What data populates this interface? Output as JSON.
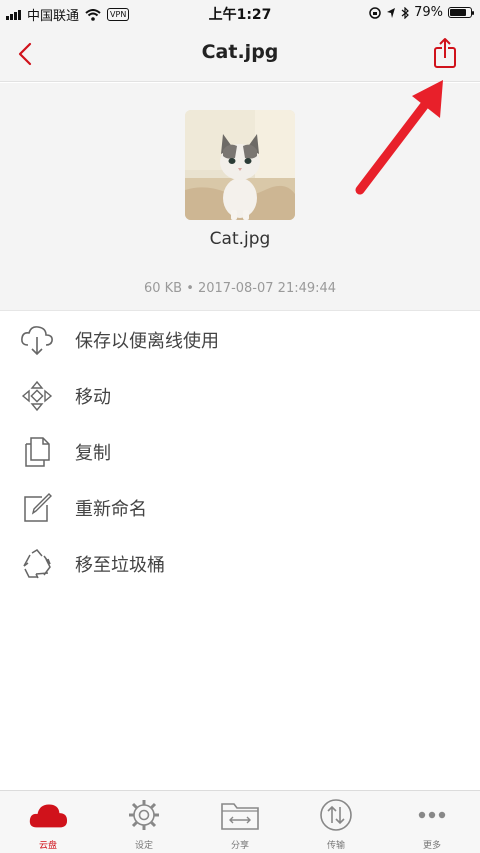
{
  "status_bar": {
    "carrier": "中国联通",
    "vpn": "VPN",
    "time": "上午1:27",
    "battery": "79%",
    "battery_level": 0.79
  },
  "nav": {
    "title": "Cat.jpg"
  },
  "file": {
    "name": "Cat.jpg",
    "meta": "60 KB • 2017-08-07 21:49:44"
  },
  "actions": [
    {
      "label": "保存以便离线使用",
      "icon": "cloud-download-icon"
    },
    {
      "label": "移动",
      "icon": "move-arrows-icon"
    },
    {
      "label": "复制",
      "icon": "copy-icon"
    },
    {
      "label": "重新命名",
      "icon": "edit-icon"
    },
    {
      "label": "移至垃圾桶",
      "icon": "recycle-icon"
    }
  ],
  "tabs": [
    {
      "label": "云盘",
      "icon": "cloud-icon",
      "active": true
    },
    {
      "label": "设定",
      "icon": "gear-icon",
      "active": false
    },
    {
      "label": "分享",
      "icon": "folder-share-icon",
      "active": false
    },
    {
      "label": "传输",
      "icon": "transfer-icon",
      "active": false
    },
    {
      "label": "更多",
      "icon": "more-icon",
      "active": false
    }
  ],
  "colors": {
    "accent": "#d0121b",
    "annotation": "#e8202a"
  }
}
